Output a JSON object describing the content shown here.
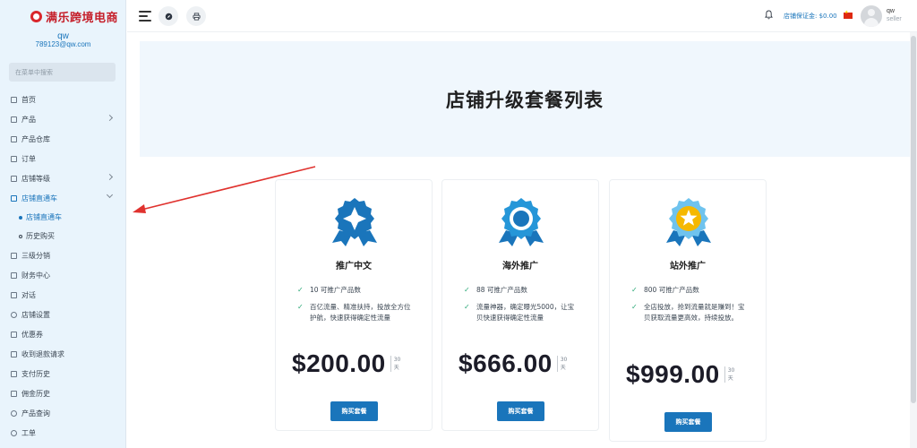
{
  "brand": {
    "name": "满乐跨境电商"
  },
  "user": {
    "name": "qw",
    "email": "789123@qw.com",
    "role": "seller"
  },
  "sidebar": {
    "search_placeholder": "在菜单中搜索",
    "items": [
      {
        "label": "首页",
        "icon": "home-icon"
      },
      {
        "label": "产品",
        "icon": "cart-icon",
        "chevron": "right"
      },
      {
        "label": "产品仓库",
        "icon": "warehouse-icon"
      },
      {
        "label": "订单",
        "icon": "order-icon"
      },
      {
        "label": "店铺等级",
        "icon": "cart-icon",
        "chevron": "right"
      },
      {
        "label": "店铺直通车",
        "icon": "cart-icon",
        "chevron": "down",
        "active": true
      },
      {
        "label": "店铺直通车",
        "sub": true,
        "active": true
      },
      {
        "label": "历史购买",
        "sub": true
      },
      {
        "label": "三级分销",
        "icon": "users-icon"
      },
      {
        "label": "财务中心",
        "icon": "wallet-icon"
      },
      {
        "label": "对话",
        "icon": "chat-icon"
      },
      {
        "label": "店铺设置",
        "icon": "gear-icon"
      },
      {
        "label": "优惠券",
        "icon": "coupon-icon"
      },
      {
        "label": "收到退款请求",
        "icon": "refund-icon"
      },
      {
        "label": "支付历史",
        "icon": "history-icon"
      },
      {
        "label": "佣金历史",
        "icon": "document-icon"
      },
      {
        "label": "产品查询",
        "icon": "help-icon"
      },
      {
        "label": "工单",
        "icon": "ticket-icon"
      }
    ]
  },
  "topbar": {
    "deposit_label": "店铺保证金: $0.00",
    "language_flag": "cn-flag-icon"
  },
  "page": {
    "title": "店铺升级套餐列表"
  },
  "plans": [
    {
      "name": "推广中文",
      "features": [
        "10 可推广产品数",
        "百亿流量、精准扶持，投放全方位护航，快速获得确定性流量"
      ],
      "price": "$200.00",
      "period_num": "30",
      "period_unit": "天",
      "buy_label": "购买套餐",
      "color": "#1a75bb"
    },
    {
      "name": "海外推广",
      "features": [
        "88 可推广产品数",
        "流量神器，确定曝光5000，让宝贝快速获得确定性流量"
      ],
      "price": "$666.00",
      "period_num": "30",
      "period_unit": "天",
      "buy_label": "购买套餐",
      "color": "#1a75bb"
    },
    {
      "name": "站外推广",
      "features": [
        "800 可推广产品数",
        "全店投放，抢到流量就是赚到！宝贝获取流量更高效，持续投放。"
      ],
      "price": "$999.00",
      "period_num": "30",
      "period_unit": "天",
      "buy_label": "购买套餐",
      "color": "#f5b800"
    }
  ]
}
